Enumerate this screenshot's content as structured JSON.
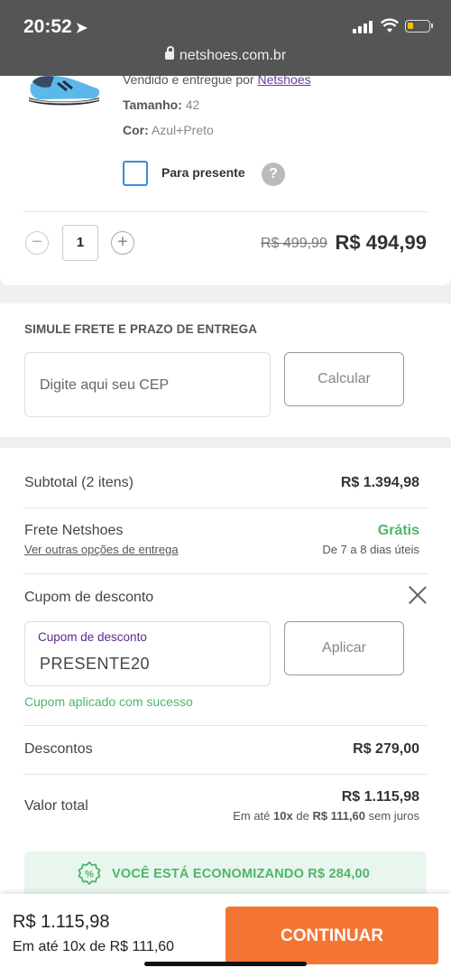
{
  "status": {
    "time": "20:52",
    "url": "netshoes.com.br"
  },
  "product": {
    "seller_prefix": "Vendido e entregue por",
    "seller_name": "Netshoes",
    "size_label": "Tamanho:",
    "size_value": "42",
    "color_label": "Cor:",
    "color_value": "Azul+Preto",
    "gift_label": "Para presente",
    "help_symbol": "?",
    "quantity": "1",
    "old_price": "R$ 499,99",
    "new_price": "R$ 494,99"
  },
  "shipping": {
    "title": "SIMULE FRETE E PRAZO DE ENTREGA",
    "cep_placeholder": "Digite aqui seu CEP",
    "calc_label": "Calcular"
  },
  "summary": {
    "subtotal_label": "Subtotal (2 itens)",
    "subtotal_value": "R$ 1.394,98",
    "freight_label": "Frete Netshoes",
    "freight_value": "Grátis",
    "freight_link": "Ver outras opções de entrega",
    "freight_time": "De 7 a 8 dias úteis",
    "coupon_title": "Cupom de desconto",
    "coupon_field_label": "Cupom de desconto",
    "coupon_value": "PRESENTE20",
    "apply_label": "Aplicar",
    "coupon_success": "Cupom aplicado com sucesso",
    "discount_label": "Descontos",
    "discount_value": "R$ 279,00",
    "total_label": "Valor total",
    "total_value": "R$ 1.115,98",
    "installments_prefix": "Em até",
    "installments_count": "10x",
    "installments_mid": "de",
    "installments_value": "R$ 111,60",
    "installments_suffix": "sem juros",
    "savings_text": "VOCÊ ESTÁ ECONOMIZANDO R$ 284,00"
  },
  "footer": {
    "total": "R$ 1.115,98",
    "installments": "Em até 10x de R$ 111,60",
    "continue_label": "CONTINUAR"
  },
  "colors": {
    "accent": "#f47432",
    "success": "#4fb56a",
    "link": "#6a3c9e",
    "checkbox": "#3a8bd8"
  }
}
